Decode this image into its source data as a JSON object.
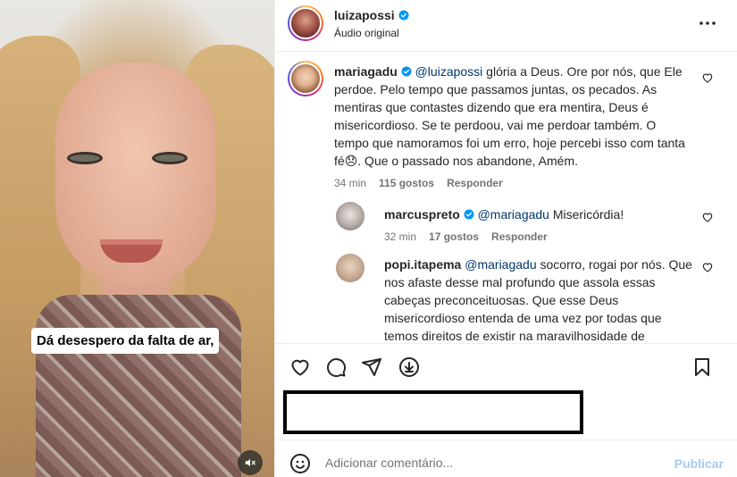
{
  "video": {
    "caption": "Dá desespero da falta de ar,",
    "mute_icon": "speaker-muted-icon"
  },
  "header": {
    "username": "luizapossi",
    "subtitle": "Áudio original",
    "more_icon": "more-horizontal-icon"
  },
  "comments": [
    {
      "username": "mariagadu",
      "mention": "@luizapossi",
      "text": " glória a Deus. Ore por nós, que Ele perdoe. Pelo tempo que passamos juntas, os pecados. As mentiras que contastes dizendo que era mentira, Deus é misericordioso. Se te perdoou, vai me perdoar também. O tempo que namoramos foi um erro, hoje percebi isso com tanta fé😞. Que o passado nos abandone, Amém.",
      "time": "34 min",
      "likes": "115 gostos",
      "reply": "Responder"
    },
    {
      "username": "marcuspreto",
      "mention": "@mariagadu",
      "text": " Misericórdia!",
      "time": "32 min",
      "likes": "17 gostos",
      "reply": "Responder"
    },
    {
      "username": "popi.itapema",
      "mention": "@mariagadu",
      "text": " socorro, rogai por nós. Que nos afaste desse mal profundo que assola essas cabeças preconceituosas. Que esse Deus misericordioso entenda de uma vez por todas que temos direitos de existir na maravilhosidade de pluralidade que ele criou. Arrasou, Mal ❤️❤️"
    }
  ],
  "actions": {
    "like_icon": "heart-icon",
    "comment_icon": "comment-icon",
    "share_icon": "send-icon",
    "save_icon": "bookmark-icon"
  },
  "add_comment": {
    "placeholder": "Adicionar comentário...",
    "publish_label": "Publicar",
    "emoji_icon": "emoji-icon"
  },
  "colors": {
    "verified": "#0095f6",
    "mention": "#00376b",
    "publish": "#a6c8f5",
    "meta": "#737373"
  }
}
